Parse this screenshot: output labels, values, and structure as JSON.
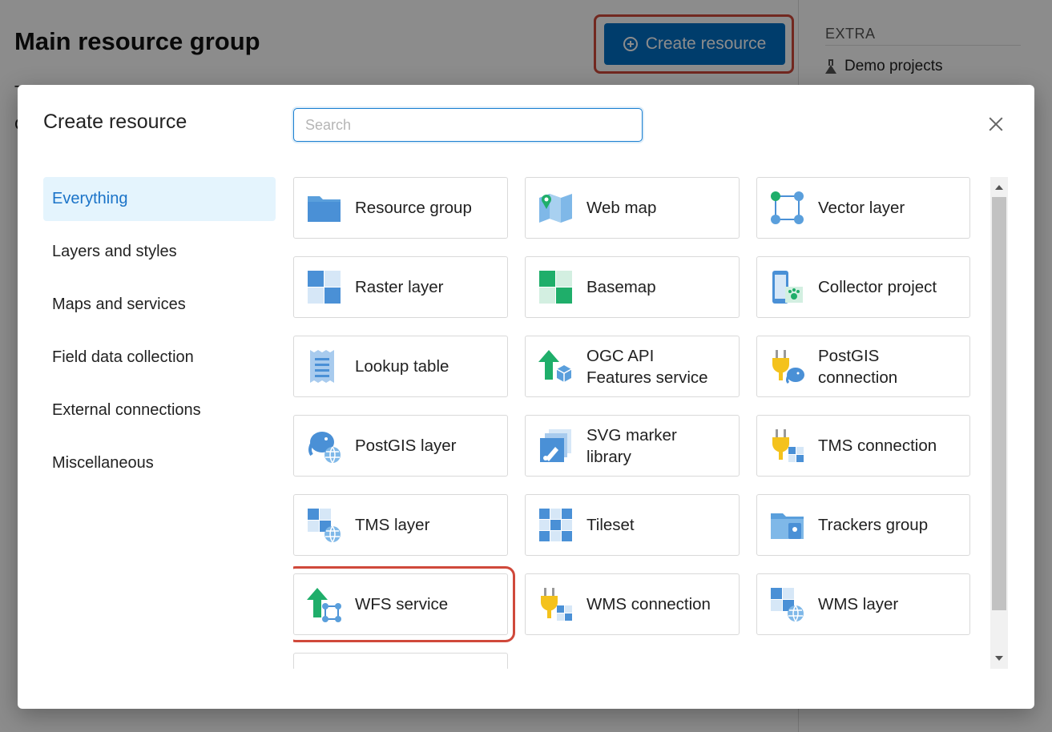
{
  "background": {
    "page_title": "Main resource group",
    "create_button_label": "Create resource",
    "fragment_1": "T",
    "fragment_2": "C",
    "extra_heading": "EXTRA",
    "demo_link": "Demo projects"
  },
  "modal": {
    "title": "Create resource",
    "search_placeholder": "Search",
    "search_value": "",
    "categories": [
      {
        "label": "Everything",
        "active": true
      },
      {
        "label": "Layers and styles",
        "active": false
      },
      {
        "label": "Maps and services",
        "active": false
      },
      {
        "label": "Field data collection",
        "active": false
      },
      {
        "label": "External connections",
        "active": false
      },
      {
        "label": "Miscellaneous",
        "active": false
      }
    ],
    "resources": [
      {
        "label": "Resource group",
        "icon": "folder-icon"
      },
      {
        "label": "Web map",
        "icon": "web-map-icon"
      },
      {
        "label": "Vector layer",
        "icon": "vector-layer-icon"
      },
      {
        "label": "Raster layer",
        "icon": "raster-layer-icon"
      },
      {
        "label": "Basemap",
        "icon": "basemap-icon"
      },
      {
        "label": "Collector project",
        "icon": "collector-project-icon"
      },
      {
        "label": "Lookup table",
        "icon": "lookup-table-icon"
      },
      {
        "label": "OGC API\nFeatures service",
        "icon": "ogc-api-icon"
      },
      {
        "label": "PostGIS\nconnection",
        "icon": "postgis-connection-icon"
      },
      {
        "label": "PostGIS layer",
        "icon": "postgis-layer-icon"
      },
      {
        "label": "SVG marker\nlibrary",
        "icon": "svg-marker-library-icon"
      },
      {
        "label": "TMS connection",
        "icon": "tms-connection-icon"
      },
      {
        "label": "TMS layer",
        "icon": "tms-layer-icon"
      },
      {
        "label": "Tileset",
        "icon": "tileset-icon"
      },
      {
        "label": "Trackers group",
        "icon": "trackers-group-icon"
      },
      {
        "label": "WFS service",
        "icon": "wfs-service-icon"
      },
      {
        "label": "WMS connection",
        "icon": "wms-connection-icon"
      },
      {
        "label": "WMS layer",
        "icon": "wms-layer-icon"
      }
    ],
    "highlighted_resource": "WFS service",
    "colors": {
      "accent": "#1a73c8",
      "active_bg": "#e4f4fd",
      "highlight": "#d0493b",
      "primary_button": "#0070c5"
    }
  }
}
